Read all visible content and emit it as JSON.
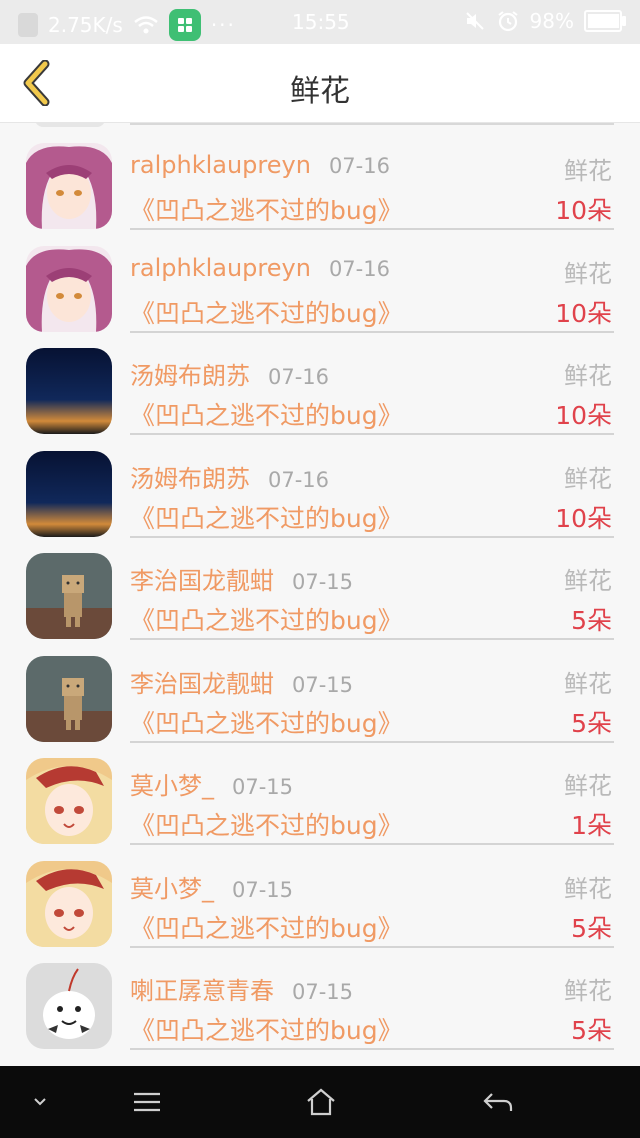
{
  "status_bar": {
    "speed": "2.75K/s",
    "time": "15:55",
    "battery": "98%",
    "dots": "···"
  },
  "header": {
    "title": "鲜花"
  },
  "records": [
    {
      "user": "ralphklaupreyn",
      "date": "07-16",
      "type": "鲜花",
      "book": "《凹凸之逃不过的bug》",
      "count": "10朵",
      "avatar": "anime-pink-hair"
    },
    {
      "user": "ralphklaupreyn",
      "date": "07-16",
      "type": "鲜花",
      "book": "《凹凸之逃不过的bug》",
      "count": "10朵",
      "avatar": "anime-pink-hair"
    },
    {
      "user": "汤姆布朗苏",
      "date": "07-16",
      "type": "鲜花",
      "book": "《凹凸之逃不过的bug》",
      "count": "10朵",
      "avatar": "night-sky"
    },
    {
      "user": "汤姆布朗苏",
      "date": "07-16",
      "type": "鲜花",
      "book": "《凹凸之逃不过的bug》",
      "count": "10朵",
      "avatar": "night-sky"
    },
    {
      "user": "李治国龙靓蚶",
      "date": "07-15",
      "type": "鲜花",
      "book": "《凹凸之逃不过的bug》",
      "count": "5朵",
      "avatar": "cardboard-figure"
    },
    {
      "user": "李治国龙靓蚶",
      "date": "07-15",
      "type": "鲜花",
      "book": "《凹凸之逃不过的bug》",
      "count": "5朵",
      "avatar": "cardboard-figure"
    },
    {
      "user": "莫小梦_",
      "date": "07-15",
      "type": "鲜花",
      "book": "《凹凸之逃不过的bug》",
      "count": "1朵",
      "avatar": "anime-blonde-girl"
    },
    {
      "user": "莫小梦_",
      "date": "07-15",
      "type": "鲜花",
      "book": "《凹凸之逃不过的bug》",
      "count": "5朵",
      "avatar": "anime-blonde-girl"
    },
    {
      "user": "喇正孱意青春",
      "date": "07-15",
      "type": "鲜花",
      "book": "《凹凸之逃不过的bug》",
      "count": "5朵",
      "avatar": "white-plush-toy"
    }
  ],
  "colors": {
    "accent": "#f09a64",
    "count": "#e0424b",
    "muted": "#a9a9a9",
    "back_arrow": "#f2c94c"
  },
  "navigation": {
    "icons": [
      "chevron-down-icon",
      "menu-icon",
      "home-icon",
      "back-arrow-icon"
    ]
  }
}
